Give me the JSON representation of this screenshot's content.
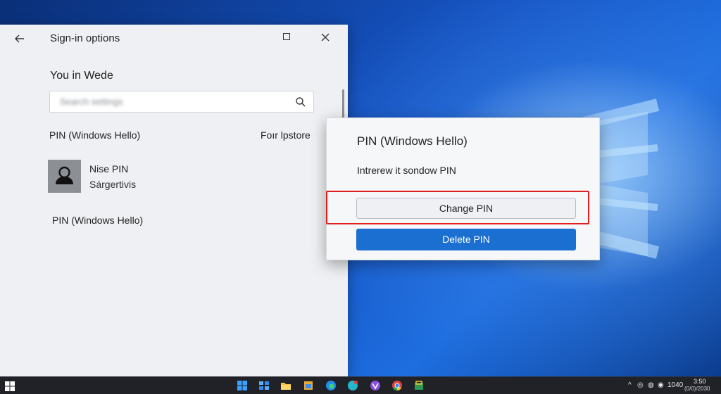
{
  "window": {
    "title": "Sign-in options",
    "back_icon": "arrow-left-icon",
    "maximize_icon": "maximize-icon",
    "close_icon": "close-icon"
  },
  "main": {
    "heading": "You in Wede",
    "search_value": "Search settings",
    "search_icon": "search-icon",
    "pin_label": "PIN (Windows Hello)",
    "right_link": "Foır lpstore",
    "option_title": "Nise PIN",
    "option_subtitle": "Sárgertivis",
    "pin_label_2": "PIN (Windows Hello)"
  },
  "popup": {
    "title": "PIN (Windows Hello)",
    "description": "Intrerew it sondow PIN",
    "change_label": "Change PIN",
    "delete_label": "Delete PIN",
    "highlight_color": "#e02020",
    "primary_color": "#1b6fd0"
  },
  "taskbar": {
    "time": "3:50",
    "date": "(0/0)/2030",
    "tray_lang": "1040",
    "apps": [
      "windows-start-icon",
      "widgets-icon",
      "file-explorer-icon",
      "folder-icon",
      "edge-icon",
      "edge-dev-icon",
      "app-purple-icon",
      "chrome-icon",
      "store-icon"
    ]
  }
}
